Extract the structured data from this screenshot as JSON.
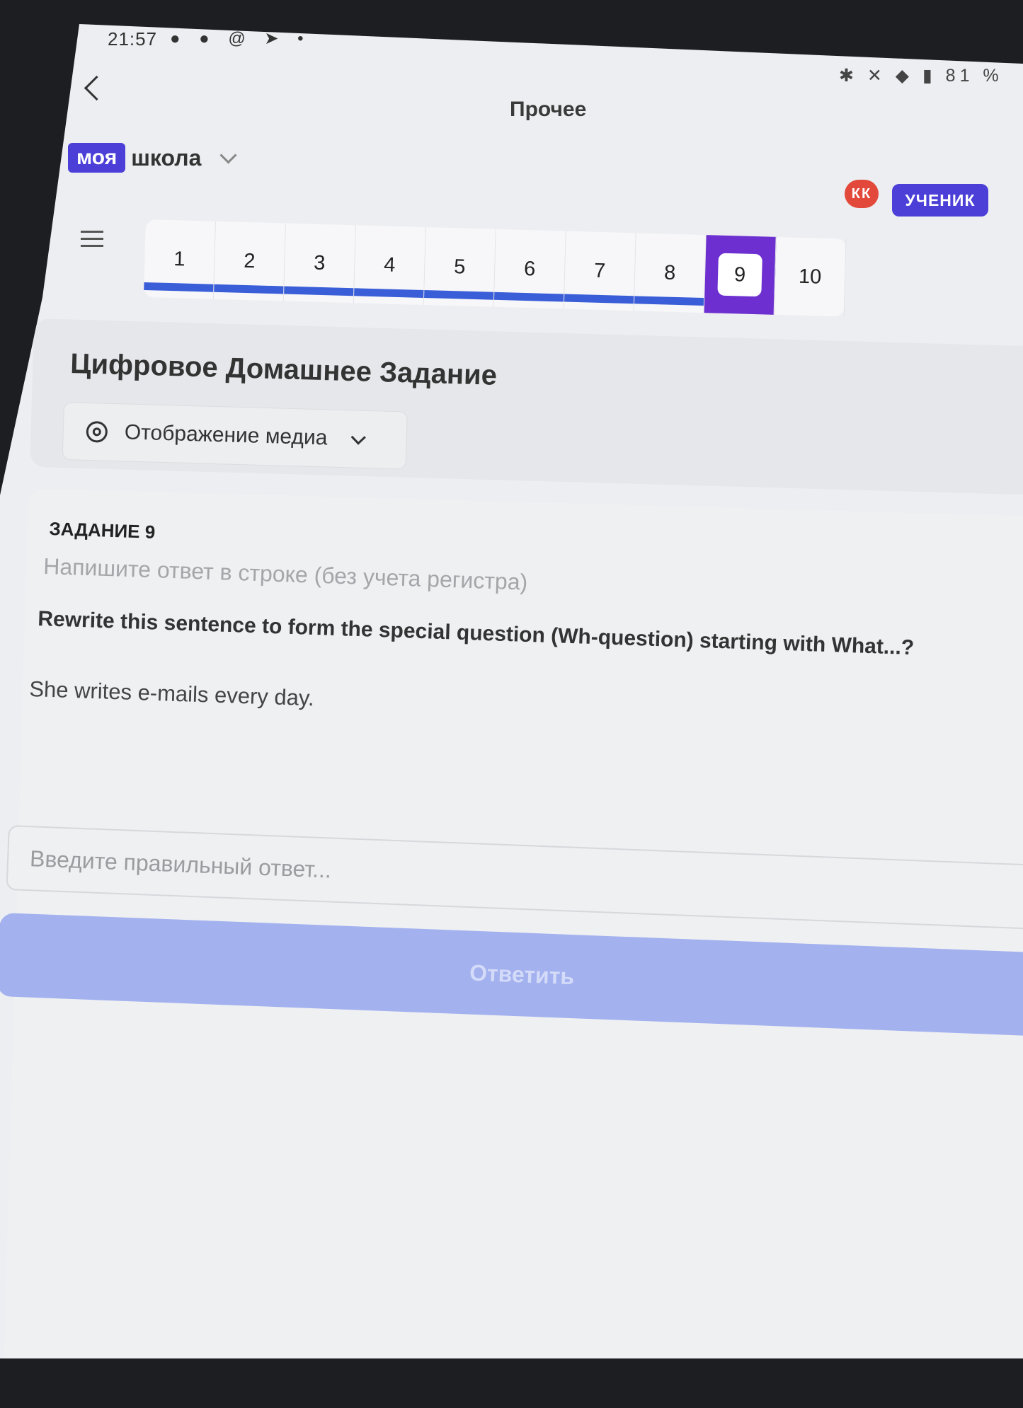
{
  "status_bar": {
    "time": "21:57",
    "left_icons": "● ● @ ➤ •",
    "right_icons": "✱ ✕ ◆ ▮",
    "battery": "81 %"
  },
  "header": {
    "title": "Прочее",
    "back_icon": "chevron-left-icon"
  },
  "logo": {
    "part1": "моя",
    "part2": "школа"
  },
  "user": {
    "initials": "КК",
    "role": "УЧЕНИК"
  },
  "task_nav": {
    "tasks": [
      "1",
      "2",
      "3",
      "4",
      "5",
      "6",
      "7",
      "8",
      "9",
      "10"
    ],
    "active": "9",
    "completed": [
      "1",
      "2",
      "3",
      "4",
      "5",
      "6",
      "7",
      "8"
    ]
  },
  "homework": {
    "title": "Цифровое Домашнее Задание",
    "media_toggle": "Отображение медиа"
  },
  "task": {
    "heading": "ЗАДАНИЕ 9",
    "hint": "Напишите ответ в строке (без учета регистра)",
    "question": "Rewrite this sentence to form the special question (Wh-question)  starting with What...?",
    "sentence": "She writes e-mails every day.",
    "answer_placeholder": "Введите правильный ответ...",
    "submit_label": "Ответить"
  },
  "colors": {
    "brand": "#4b3fd8",
    "active_task": "#6d2fd0",
    "progress": "#3a5ed8",
    "submit_disabled": "#a3b1ef",
    "avatar": "#e2493b"
  }
}
